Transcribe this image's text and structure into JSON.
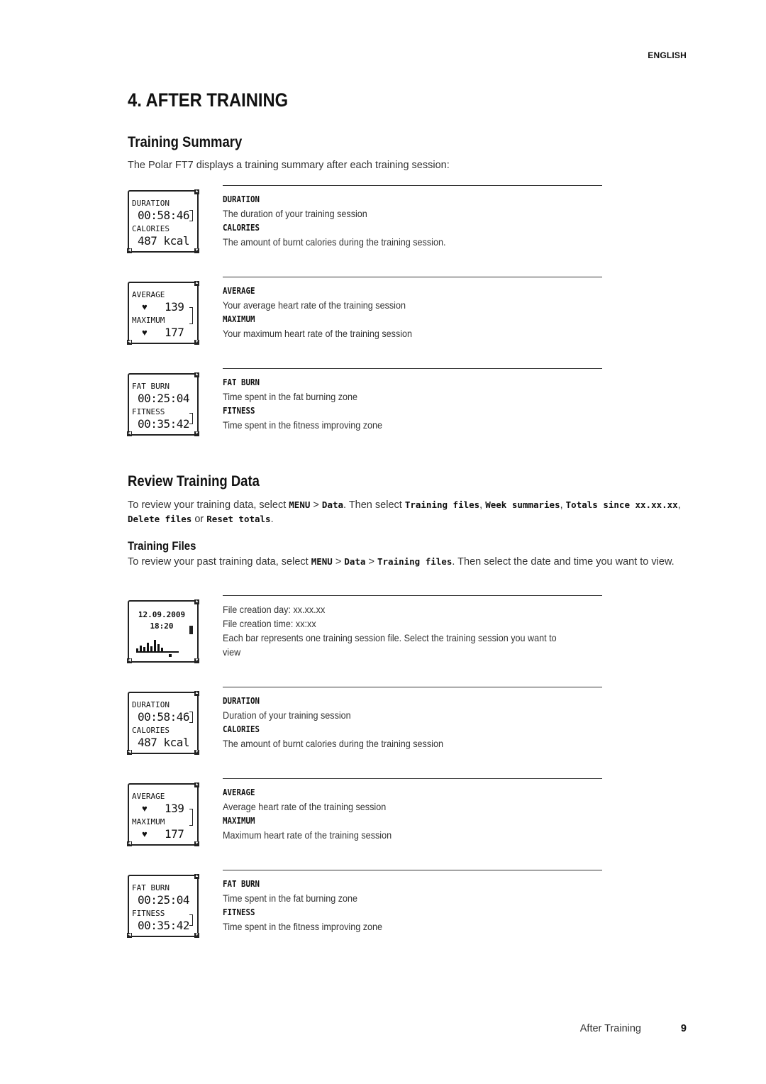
{
  "header": {
    "language": "ENGLISH"
  },
  "chapter_title": "4. AFTER TRAINING",
  "training_summary": {
    "title": "Training Summary",
    "intro": "The Polar FT7 displays a training summary after each training session:",
    "rows": [
      {
        "watch": {
          "label1": "DURATION",
          "value1": "00:58:46",
          "label2": "CALORIES",
          "value2": "487 kcal"
        },
        "label1": "DURATION",
        "desc1": "The duration of your training session",
        "label2": "CALORIES",
        "desc2": "The amount of burnt calories during the training session."
      },
      {
        "watch": {
          "label1": "AVERAGE",
          "value1": "139",
          "label2": "MAXIMUM",
          "value2": "177"
        },
        "label1": "AVERAGE",
        "desc1": "Your average heart rate of the training session",
        "label2": "MAXIMUM",
        "desc2": "Your maximum heart rate of the training session"
      },
      {
        "watch": {
          "label1": "FAT BURN",
          "value1": "00:25:04",
          "label2": "FITNESS",
          "value2": "00:35:42"
        },
        "label1": "FAT BURN",
        "desc1": "Time spent in the fat burning zone",
        "label2": "FITNESS",
        "desc2": "Time spent in the fitness improving zone"
      }
    ]
  },
  "review": {
    "title": "Review Training Data",
    "p_start": "To review your training data, select ",
    "menu": "MENU",
    "sep": " > ",
    "data": "Data",
    "p_mid": ". Then select ",
    "opt1": "Training files",
    "comma": ", ",
    "opt2": "Week summaries",
    "opt3": "Totals since xx.xx.xx",
    "opt4": "Delete files",
    "or": " or ",
    "opt5": "Reset totals",
    "period": "."
  },
  "training_files": {
    "title": "Training Files",
    "p_start": "To review your past training data, select ",
    "menu": "MENU",
    "data": "Data",
    "files": "Training files",
    "p_end": ". Then select the date and time you want to view.",
    "file_row": {
      "watch": {
        "date": "12.09.2009",
        "time": "18:20"
      },
      "line1": "File creation day: xx.xx.xx",
      "line2": "File creation time: xx:xx",
      "line3": "Each bar represents one training session file. Select the training session you want to view"
    },
    "rows": [
      {
        "watch": {
          "label1": "DURATION",
          "value1": "00:58:46",
          "label2": "CALORIES",
          "value2": "487 kcal"
        },
        "label1": "DURATION",
        "desc1": "Duration of your training session",
        "label2": "CALORIES",
        "desc2": "The amount of burnt calories during the training session"
      },
      {
        "watch": {
          "label1": "AVERAGE",
          "value1": "139",
          "label2": "MAXIMUM",
          "value2": "177"
        },
        "label1": "AVERAGE",
        "desc1": "Average heart rate of the training session",
        "label2": "MAXIMUM",
        "desc2": "Maximum heart rate of the training session"
      },
      {
        "watch": {
          "label1": "FAT BURN",
          "value1": "00:25:04",
          "label2": "FITNESS",
          "value2": "00:35:42"
        },
        "label1": "FAT BURN",
        "desc1": "Time spent in the fat burning zone",
        "label2": "FITNESS",
        "desc2": "Time spent in the fitness improving zone"
      }
    ]
  },
  "footer": {
    "section": "After Training",
    "page": "9"
  }
}
